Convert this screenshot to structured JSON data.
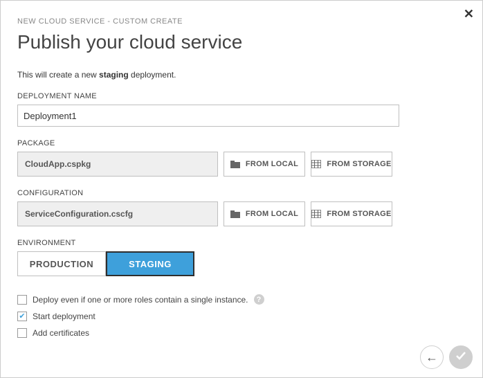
{
  "breadcrumb": "NEW CLOUD SERVICE - CUSTOM CREATE",
  "title": "Publish your cloud service",
  "intro_prefix": "This will create a new ",
  "intro_bold": "staging",
  "intro_suffix": " deployment.",
  "deployment": {
    "label": "DEPLOYMENT NAME",
    "value": "Deployment1"
  },
  "package": {
    "label": "PACKAGE",
    "file": "CloudApp.cspkg",
    "from_local": "FROM LOCAL",
    "from_storage": "FROM STORAGE"
  },
  "configuration": {
    "label": "CONFIGURATION",
    "file": "ServiceConfiguration.cscfg",
    "from_local": "FROM LOCAL",
    "from_storage": "FROM STORAGE"
  },
  "environment": {
    "label": "ENVIRONMENT",
    "production": "PRODUCTION",
    "staging": "STAGING"
  },
  "checkboxes": {
    "single_instance": "Deploy even if one or more roles contain a single instance.",
    "start_deployment": "Start deployment",
    "add_certificates": "Add certificates"
  },
  "help_glyph": "?",
  "close_glyph": "✕",
  "check_glyph": "✔",
  "back_glyph": "←"
}
